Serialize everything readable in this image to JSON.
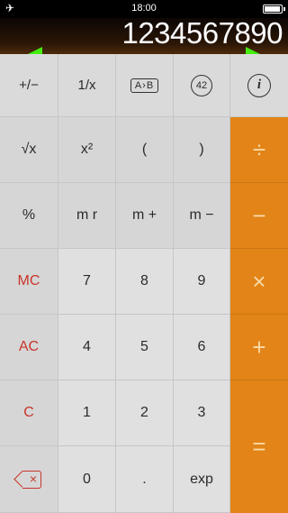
{
  "status_bar": {
    "time": "18:00",
    "icon_left": "airplane-icon",
    "icon_right": "battery-icon"
  },
  "display": {
    "value": "1234567890"
  },
  "gesture": {
    "icons": [
      "arrow-left-icon",
      "arrow-right-icon"
    ]
  },
  "keys": {
    "row0": {
      "plus_minus": "+/−",
      "reciprocal": "1/x",
      "ab": "A›B",
      "num42": "42",
      "info": "i"
    },
    "row1": {
      "sqrt": "√x",
      "square": "x²",
      "lparen": "(",
      "rparen": ")",
      "divide": "÷"
    },
    "row2": {
      "percent": "%",
      "mr": "m r",
      "mplus": "m +",
      "mminus": "m −",
      "minus": "−"
    },
    "row3": {
      "mc": "MC",
      "seven": "7",
      "eight": "8",
      "nine": "9",
      "times": "×"
    },
    "row4": {
      "ac": "AC",
      "four": "4",
      "five": "5",
      "six": "6",
      "plus": "+"
    },
    "row5": {
      "c": "C",
      "one": "1",
      "two": "2",
      "three": "3",
      "equals": "="
    },
    "row6": {
      "backspace_icon": "backspace-icon",
      "zero": "0",
      "dot": ".",
      "exp": "exp"
    }
  },
  "colors": {
    "operator_bg": "#e28417",
    "memory_text": "#c9352b",
    "gesture_green": "#44ee11"
  }
}
